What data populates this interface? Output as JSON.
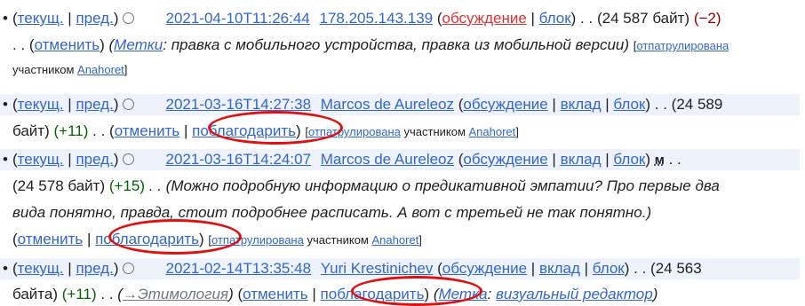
{
  "entries": [
    {
      "cur": "текущ.",
      "prev": "пред.",
      "date": "2021-04-10T11:26:44",
      "user": "178.205.143.139",
      "talk": "обсуждение",
      "block": "блок",
      "size": "(24 587 байт)",
      "diff": "(−2)",
      "dots": ". .",
      "undo": "отменить",
      "tags_label": "Метки",
      "tags_text": ": правка с мобильного устройства, правка из мобильной версии)",
      "patrolled": "отпатрулирована",
      "patrolled_by": "участником",
      "patroller": "Anahoret"
    },
    {
      "cur": "текущ.",
      "prev": "пред.",
      "date": "2021-03-16T14:27:38",
      "user": "Marcos de Aureleoz",
      "talk": "обсуждение",
      "contrib": "вклад",
      "block": "блок",
      "size_a": ". . (24 589",
      "size_b": "байт)",
      "diff": "(+11)",
      "dots": ". .",
      "undo": "отменить",
      "thank": "поблагодарить",
      "patrolled": "отпатрулирована",
      "patrolled_by": "участником",
      "patroller": "Anahoret"
    },
    {
      "cur": "текущ.",
      "prev": "пред.",
      "date": "2021-03-16T14:24:07",
      "user": "Marcos de Aureleoz",
      "talk": "обсуждение",
      "contrib": "вклад",
      "block": "блок",
      "minor": "м",
      "size": "(24 578 байт)",
      "diff": "(+15)",
      "summary_1": ". . (Можно подробную информацию о предикативной эмпатии? Про первые два",
      "summary_2": "вида понятно, правда, стоит подробнее расписать. А вот с третьей не так понятно.)",
      "undo": "отменить",
      "thank": "поблагодарить",
      "patrolled": "отпатрулирована",
      "patrolled_by": "участником",
      "patroller": "Anahoret"
    },
    {
      "cur": "текущ.",
      "prev": "пред.",
      "date": "2021-02-14T13:35:48",
      "user": "Yuri Krestinichev",
      "talk": "обсуждение",
      "contrib": "вклад",
      "block": "блок",
      "size_a": ". . (24 563",
      "size_b": "байта)",
      "diff": "(+11)",
      "section_link": "→Этимология",
      "undo": "отменить",
      "thank": "поблагодарить",
      "tag_label": "Метка",
      "tag_value": "визуальный редактор"
    }
  ],
  "colors": {
    "link": "#3366cc",
    "positive": "#006400",
    "negative": "#8b0000",
    "annotation": "#e01010"
  }
}
